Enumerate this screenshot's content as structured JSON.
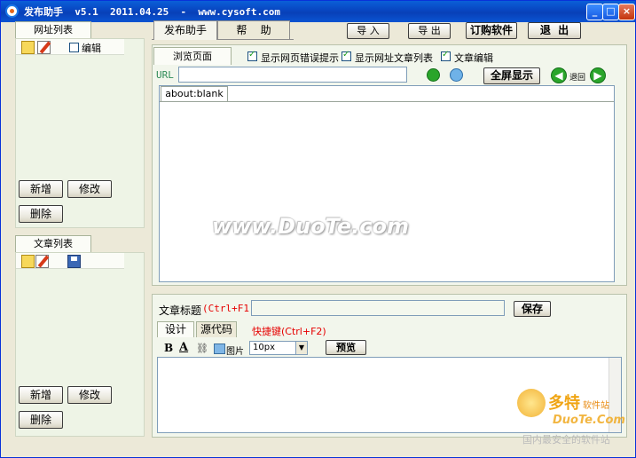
{
  "window": {
    "title": "发布助手  v5.1  2011.04.25  -  www.cysoft.com",
    "controls": [
      "_",
      "□",
      "×"
    ]
  },
  "left": {
    "url_list_tab": "网址列表",
    "url_edit_label": "编辑",
    "url_add": "新增",
    "url_modify": "修改",
    "url_delete": "删除",
    "article_list_tab": "文章列表",
    "article_add": "新增",
    "article_modify": "修改",
    "article_delete": "删除"
  },
  "top_tabs": [
    "发布助手",
    "帮    助"
  ],
  "toolbar": {
    "import": "导 入",
    "export": "导 出",
    "buy": "订购软件",
    "exit": "退  出"
  },
  "browse": {
    "tab": "浏览页面",
    "show_errors": "显示网页错误提示",
    "show_article_list": "显示网址文章列表",
    "article_edit": "文章编辑",
    "url_label": "URL",
    "url_value": "",
    "fullscreen": "全屏显示",
    "back": "退回",
    "page_tab": "about:blank"
  },
  "editor": {
    "title_label": "文章标题",
    "title_shortcut": "(Ctrl+F1)",
    "title_value": "",
    "save": "保存",
    "design_tab": "设计",
    "source_tab": "源代码",
    "shortcut_note": "快捷键(Ctrl+F2)",
    "bold": "B",
    "font_color": "A",
    "image": "图片",
    "font_size": "10px",
    "preview": "预览"
  },
  "watermark": {
    "center": "www.DuoTe.com",
    "brand": "多特",
    "brand_sub": "软件站",
    "url": "DuoTe.Com",
    "slogan": "国内最安全的软件站"
  },
  "colors": {
    "title_bar": "#0845c0",
    "panel_bg": "#eef4e6",
    "shortcut_red": "#e60000",
    "url_label_green": "#2e8b57"
  }
}
